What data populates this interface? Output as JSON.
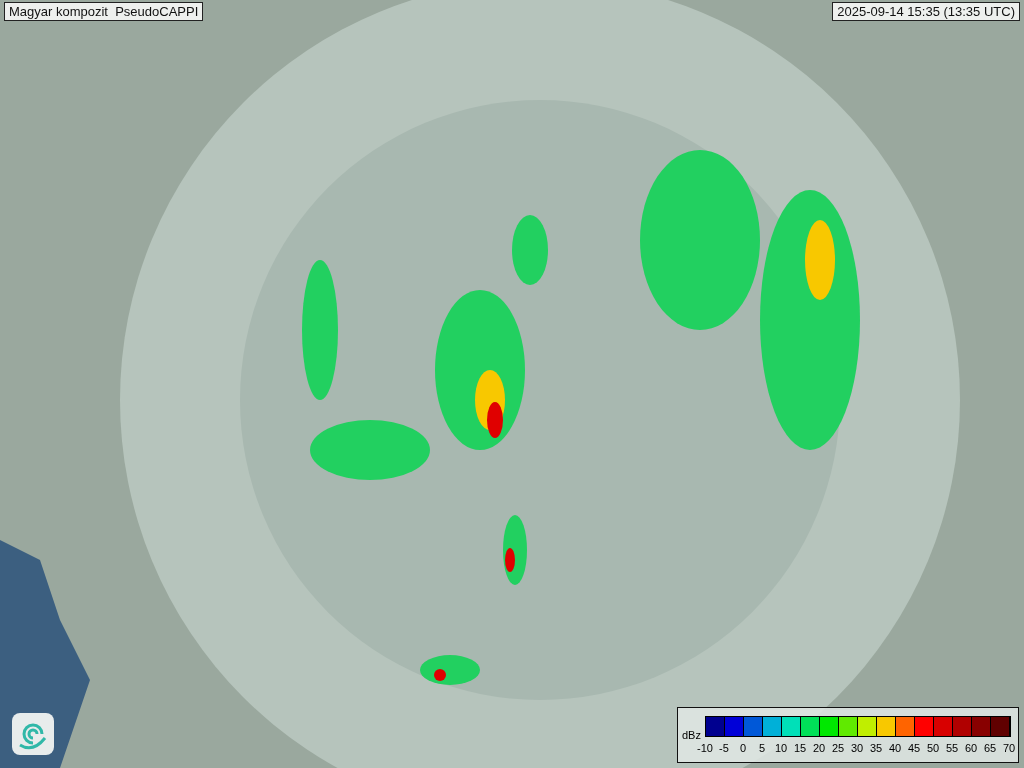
{
  "title": "Magyar kompozit  PseudoCAPPI",
  "timestamp": "2025-09-14 15:35 (13:35 UTC)",
  "legend": {
    "unit": "dBz",
    "bins": [
      {
        "color": "#00008f"
      },
      {
        "color": "#0000d8"
      },
      {
        "color": "#0058d8"
      },
      {
        "color": "#00b0d8"
      },
      {
        "color": "#00e0b8"
      },
      {
        "color": "#00e058"
      },
      {
        "color": "#00e800"
      },
      {
        "color": "#60ea00"
      },
      {
        "color": "#c0ee00"
      },
      {
        "color": "#f8c800"
      },
      {
        "color": "#ff6400"
      },
      {
        "color": "#ff0000"
      },
      {
        "color": "#d80000"
      },
      {
        "color": "#b00000"
      },
      {
        "color": "#880000"
      },
      {
        "color": "#600000"
      }
    ],
    "ticks": [
      "-10",
      "-5",
      "0",
      "5",
      "10",
      "15",
      "20",
      "25",
      "30",
      "35",
      "40",
      "45",
      "50",
      "55",
      "60",
      "65",
      "70"
    ]
  }
}
